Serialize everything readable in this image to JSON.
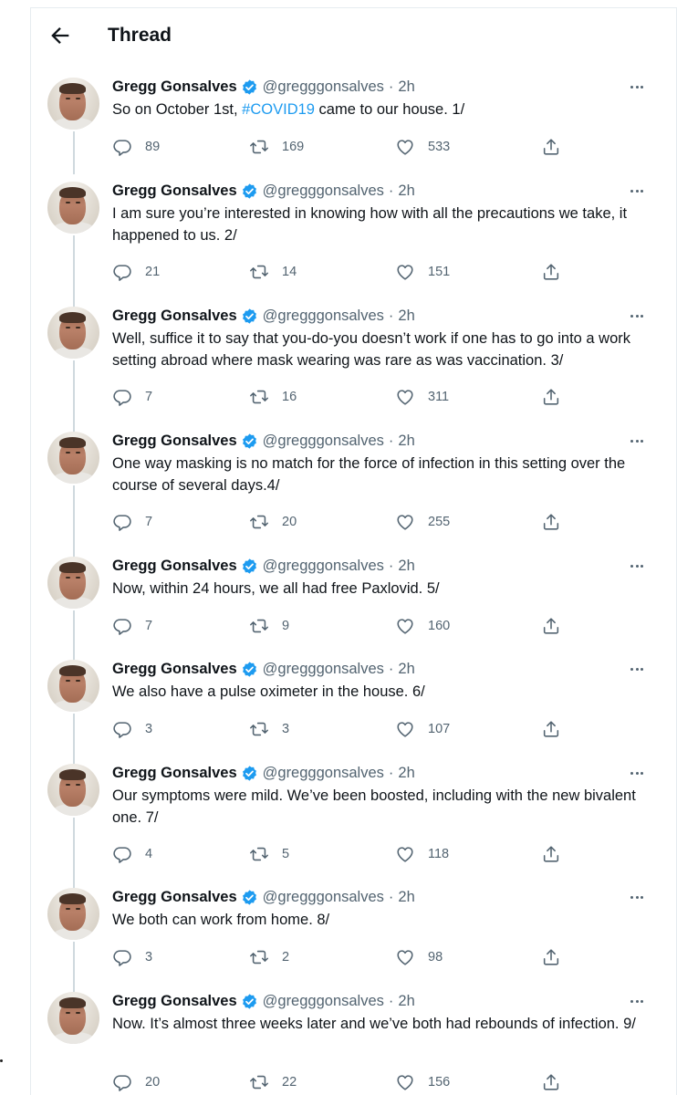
{
  "header": {
    "title": "Thread",
    "back_icon": "arrow-left-icon"
  },
  "colors": {
    "accent": "#1d9bf0",
    "text": "#0f1419",
    "muted": "#536471",
    "thread_line": "#cfd9de"
  },
  "tweets": [
    {
      "name": "Gregg Gonsalves",
      "handle": "@gregggonsalves",
      "dot": "·",
      "time": "2h",
      "text_before": "So on October 1st, ",
      "hashtag": "#COVID19",
      "text_after": " came to our house. 1/",
      "replies": "89",
      "retweets": "169",
      "likes": "533"
    },
    {
      "name": "Gregg Gonsalves",
      "handle": "@gregggonsalves",
      "dot": "·",
      "time": "2h",
      "text_before": "I am sure you’re interested in knowing how with all the precautions we take, it happened to us. 2/",
      "hashtag": "",
      "text_after": "",
      "replies": "21",
      "retweets": "14",
      "likes": "151"
    },
    {
      "name": "Gregg Gonsalves",
      "handle": "@gregggonsalves",
      "dot": "·",
      "time": "2h",
      "text_before": "Well, suffice it to say that you-do-you doesn’t work if one has to go into a work setting abroad where mask wearing was rare as was vaccination. 3/",
      "hashtag": "",
      "text_after": "",
      "replies": "7",
      "retweets": "16",
      "likes": "311"
    },
    {
      "name": "Gregg Gonsalves",
      "handle": "@gregggonsalves",
      "dot": "·",
      "time": "2h",
      "text_before": "One way masking is no match for the force of infection in this setting over the course of several days.4/",
      "hashtag": "",
      "text_after": "",
      "replies": "7",
      "retweets": "20",
      "likes": "255"
    },
    {
      "name": "Gregg Gonsalves",
      "handle": "@gregggonsalves",
      "dot": "·",
      "time": "2h",
      "text_before": "Now, within 24 hours, we all had free Paxlovid. 5/",
      "hashtag": "",
      "text_after": "",
      "replies": "7",
      "retweets": "9",
      "likes": "160"
    },
    {
      "name": "Gregg Gonsalves",
      "handle": "@gregggonsalves",
      "dot": "·",
      "time": "2h",
      "text_before": "We also have a pulse oximeter in the house. 6/",
      "hashtag": "",
      "text_after": "",
      "replies": "3",
      "retweets": "3",
      "likes": "107"
    },
    {
      "name": "Gregg Gonsalves",
      "handle": "@gregggonsalves",
      "dot": "·",
      "time": "2h",
      "text_before": "Our symptoms were mild. We’ve been boosted, including with the new bivalent one. 7/",
      "hashtag": "",
      "text_after": "",
      "replies": "4",
      "retweets": "5",
      "likes": "118"
    },
    {
      "name": "Gregg Gonsalves",
      "handle": "@gregggonsalves",
      "dot": "·",
      "time": "2h",
      "text_before": "We both can work from home. 8/",
      "hashtag": "",
      "text_after": "",
      "replies": "3",
      "retweets": "2",
      "likes": "98"
    },
    {
      "name": "Gregg Gonsalves",
      "handle": "@gregggonsalves",
      "dot": "·",
      "time": "2h",
      "text_before": "Now. It’s almost three weeks later and we’ve both had rebounds of infection. 9/",
      "hashtag": "",
      "text_after": "",
      "replies": "20",
      "retweets": "22",
      "likes": "156"
    }
  ]
}
